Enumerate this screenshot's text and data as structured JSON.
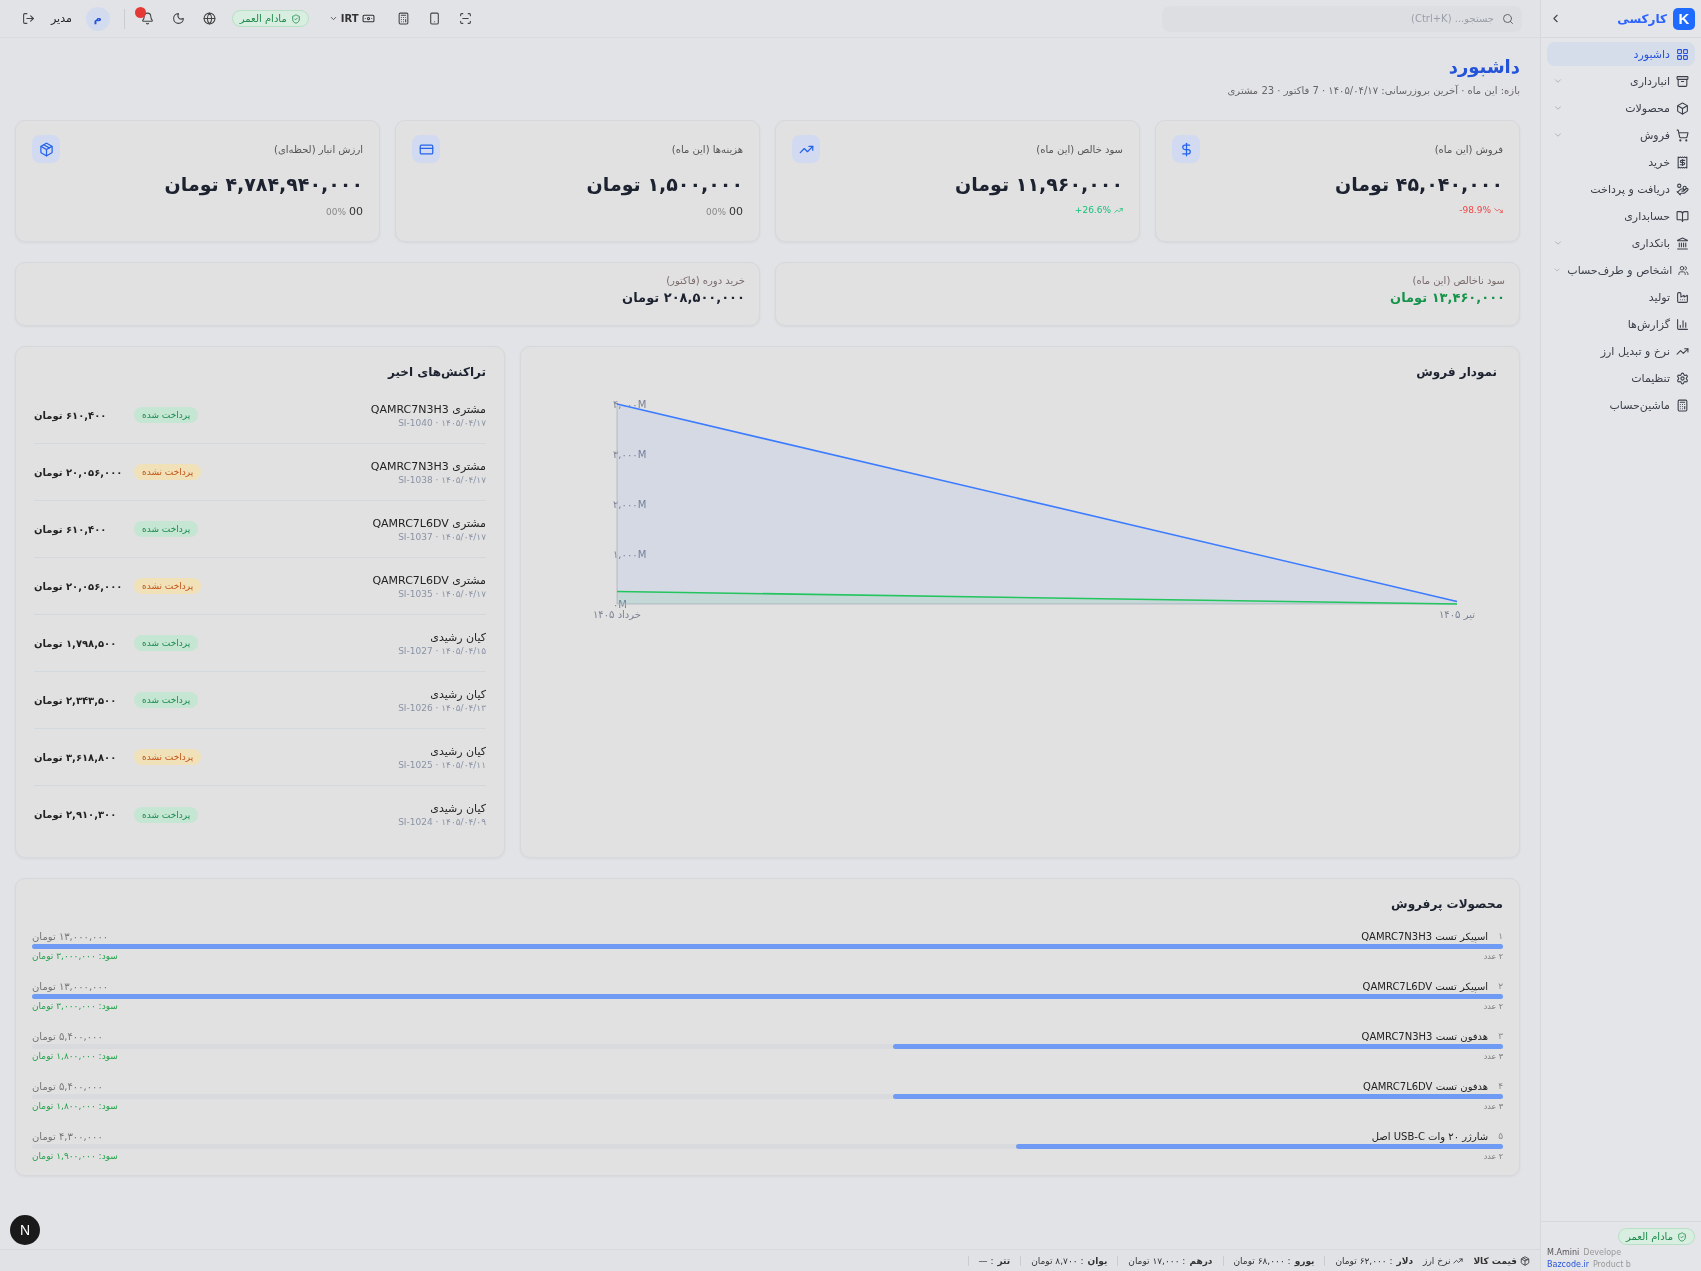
{
  "sidebar": {
    "logo_letter": "K",
    "brand": "کارکسی",
    "items": [
      {
        "label": "داشبورد",
        "selected": true,
        "expandable": false
      },
      {
        "label": "انبارداری",
        "selected": false,
        "expandable": true
      },
      {
        "label": "محصولات",
        "selected": false,
        "expandable": true
      },
      {
        "label": "فروش",
        "selected": false,
        "expandable": true
      },
      {
        "label": "خرید",
        "selected": false,
        "expandable": false
      },
      {
        "label": "دریافت و پرداخت",
        "selected": false,
        "expandable": false
      },
      {
        "label": "حسابداری",
        "selected": false,
        "expandable": false
      },
      {
        "label": "بانکداری",
        "selected": false,
        "expandable": true
      },
      {
        "label": "اشخاص و طرف‌حساب",
        "selected": false,
        "expandable": true
      },
      {
        "label": "تولید",
        "selected": false,
        "expandable": false
      },
      {
        "label": "گزارش‌ها",
        "selected": false,
        "expandable": false
      },
      {
        "label": "نرخ و تبدیل ارز",
        "selected": false,
        "expandable": false
      },
      {
        "label": "تنظیمات",
        "selected": false,
        "expandable": false
      },
      {
        "label": "ماشین‌حساب",
        "selected": false,
        "expandable": false
      }
    ],
    "license": "مادام العمر",
    "developer": "M.Amini",
    "developer_role": "Develope",
    "site": "Bazcode.ir",
    "site_note": "Product b"
  },
  "topbar": {
    "search": {
      "placeholder": "جستجو... (Ctrl+K)"
    },
    "currency": "IRT",
    "license": "مادام العمر",
    "user_initial": "م",
    "user_role": "مدیر"
  },
  "page": {
    "title": "داشبورد",
    "subtitle": "بازه: این ماه · آخرین بروزرسانی: ۱۴۰۵/۰۴/۱۷ · 7 فاکتور · 23 مشتری"
  },
  "kpis": [
    {
      "title": "فروش (این ماه)",
      "value": "۴۵,۰۴۰,۰۰۰ تومان",
      "kind": "down",
      "change": "98.9%-"
    },
    {
      "title": "سود خالص (این ماه)",
      "value": "۱۱,۹۶۰,۰۰۰ تومان",
      "kind": "up",
      "change": "26.6%+"
    },
    {
      "title": "هزینه‌ها (این ماه)",
      "value": "۱,۵۰۰,۰۰۰ تومان",
      "kind": "flat",
      "change": "00%",
      "change_value": "00"
    },
    {
      "title": "ارزش انبار (لحظه‌ای)",
      "value": "۴,۷۸۴,۹۴۰,۰۰۰ تومان",
      "kind": "flat",
      "change": "00%",
      "change_value": "00"
    }
  ],
  "summaries": [
    {
      "title": "سود ناخالص (این ماه)",
      "value": "۱۳,۴۶۰,۰۰۰ تومان",
      "highlighted": true
    },
    {
      "title": "خرید دوره (فاکتور)",
      "value": "۲۰۸,۵۰۰,۰۰۰ تومان",
      "highlighted": false
    }
  ],
  "sales_chart": {
    "title": "نمودار فروش",
    "chart_data": {
      "type": "area",
      "categories": [
        "خرداد ۱۴۰۵",
        "تیر ۱۴۰۵"
      ],
      "series": [
        {
          "color": "#3b7bff",
          "values": [
            4000,
            50
          ]
        },
        {
          "color": "#22c55e",
          "values": [
            250,
            0
          ]
        }
      ],
      "ylim": [
        0,
        4000
      ],
      "yticks": [
        {
          "value": 0,
          "label": "۰M"
        },
        {
          "value": 1000,
          "label": "۱,۰۰۰M"
        },
        {
          "value": 2000,
          "label": "۲,۰۰۰M"
        },
        {
          "value": 3000,
          "label": "۳,۰۰۰M"
        },
        {
          "value": 4000,
          "label": "۴,۰۰۰M"
        }
      ]
    }
  },
  "transactions": {
    "title": "تراکنش‌های اخیر",
    "rows": [
      {
        "name": "مشتری QAMRC7N3H3",
        "meta": "SI-1040 · ۱۴۰۵/۰۴/۱۷",
        "paid": true,
        "status_label": "پرداخت شده",
        "amount": "۶۱۰,۴۰۰ تومان"
      },
      {
        "name": "مشتری QAMRC7N3H3",
        "meta": "SI-1038 · ۱۴۰۵/۰۴/۱۷",
        "paid": false,
        "status_label": "پرداخت نشده",
        "amount": "۲۰,۰۵۶,۰۰۰ تومان"
      },
      {
        "name": "مشتری QAMRC7L6DV",
        "meta": "SI-1037 · ۱۴۰۵/۰۴/۱۷",
        "paid": true,
        "status_label": "پرداخت شده",
        "amount": "۶۱۰,۴۰۰ تومان"
      },
      {
        "name": "مشتری QAMRC7L6DV",
        "meta": "SI-1035 · ۱۴۰۵/۰۴/۱۷",
        "paid": false,
        "status_label": "پرداخت نشده",
        "amount": "۲۰,۰۵۶,۰۰۰ تومان"
      },
      {
        "name": "کیان رشیدی",
        "meta": "SI-1027 · ۱۴۰۵/۰۴/۱۵",
        "paid": true,
        "status_label": "پرداخت شده",
        "amount": "۱,۷۹۸,۵۰۰ تومان"
      },
      {
        "name": "کیان رشیدی",
        "meta": "SI-1026 · ۱۴۰۵/۰۴/۱۳",
        "paid": true,
        "status_label": "پرداخت شده",
        "amount": "۲,۳۴۳,۵۰۰ تومان"
      },
      {
        "name": "کیان رشیدی",
        "meta": "SI-1025 · ۱۴۰۵/۰۴/۱۱",
        "paid": false,
        "status_label": "پرداخت نشده",
        "amount": "۳,۶۱۸,۸۰۰ تومان"
      },
      {
        "name": "کیان رشیدی",
        "meta": "SI-1024 · ۱۴۰۵/۰۴/۰۹",
        "paid": true,
        "status_label": "پرداخت شده",
        "amount": "۲,۹۱۰,۳۰۰ تومان"
      }
    ]
  },
  "top_products": {
    "title": "محصولات پرفروش",
    "rows": [
      {
        "rank": "۱",
        "name": "اسپیکر تست QAMRC7N3H3",
        "revenue": "۱۳,۰۰۰,۰۰۰ تومان",
        "level": 1,
        "count": "۲ عدد",
        "profit": "سود: ۳,۰۰۰,۰۰۰ تومان"
      },
      {
        "rank": "۲",
        "name": "اسپیکر تست QAMRC7L6DV",
        "revenue": "۱۳,۰۰۰,۰۰۰ تومان",
        "level": 1,
        "count": "۲ عدد",
        "profit": "سود: ۳,۰۰۰,۰۰۰ تومان"
      },
      {
        "rank": "۳",
        "name": "هدفون تست QAMRC7N3H3",
        "revenue": "۵,۴۰۰,۰۰۰ تومان",
        "level": 0.415,
        "count": "۳ عدد",
        "profit": "سود: ۱,۸۰۰,۰۰۰ تومان"
      },
      {
        "rank": "۴",
        "name": "هدفون تست QAMRC7L6DV",
        "revenue": "۵,۴۰۰,۰۰۰ تومان",
        "level": 0.415,
        "count": "۳ عدد",
        "profit": "سود: ۱,۸۰۰,۰۰۰ تومان"
      },
      {
        "rank": "۵",
        "name": "شارژر ۲۰ وات USB-C اصل",
        "revenue": "۴,۳۰۰,۰۰۰ تومان",
        "level": 0.331,
        "count": "۲ عدد",
        "profit": "سود: ۱,۹۰۰,۰۰۰ تومان"
      }
    ]
  },
  "status_bar": {
    "price_label": "قیمت کالا",
    "rates_label": "نرخ ارز",
    "rates": [
      {
        "currency": "دلار",
        "value": ": ۶۲,۰۰۰ تومان"
      },
      {
        "currency": "یورو",
        "value": ": ۶۸,۰۰۰ تومان"
      },
      {
        "currency": "درهم",
        "value": ": ۱۷,۰۰۰ تومان"
      },
      {
        "currency": "یوان",
        "value": ": ۸,۷۰۰ تومان"
      },
      {
        "currency": "تتر",
        "value": ": —"
      }
    ]
  },
  "dev_badge": "N"
}
